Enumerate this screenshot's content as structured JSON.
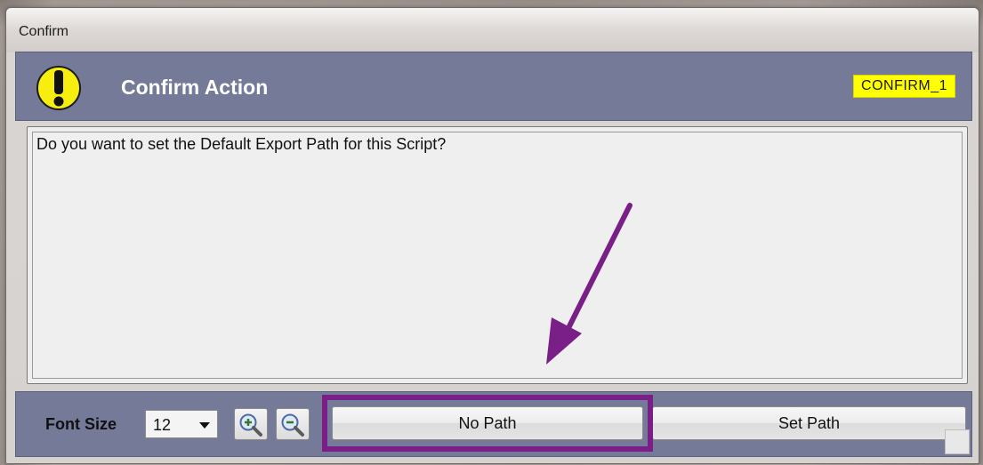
{
  "window": {
    "title": "Confirm"
  },
  "header": {
    "title": "Confirm Action",
    "code": "CONFIRM_1",
    "icon": "exclamation-warning-icon",
    "background": "#747a98",
    "code_background": "#ffff00"
  },
  "message": {
    "text": "Do you want to set the Default Export Path for this Script?"
  },
  "footer": {
    "font_size_label": "Font Size",
    "font_size_value": "12",
    "zoom_in_icon": "zoom-in-icon",
    "zoom_out_icon": "zoom-out-icon",
    "buttons": [
      {
        "label": "No Path",
        "highlighted": true
      },
      {
        "label": "Set Path",
        "highlighted": false
      }
    ]
  },
  "annotation": {
    "arrow_color": "#7a1f87",
    "highlight_color": "#7a1f87"
  }
}
